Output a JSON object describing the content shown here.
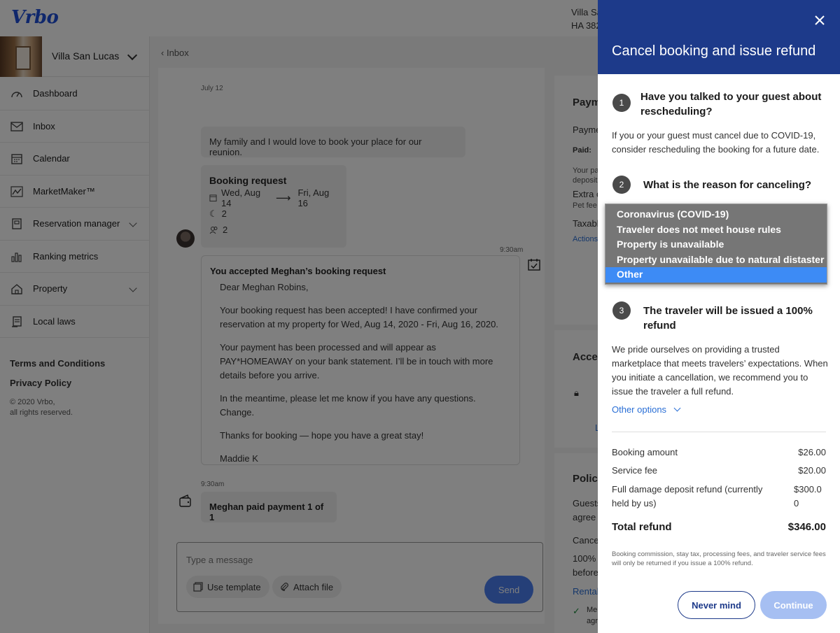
{
  "app": {
    "logo": "Vrbo"
  },
  "header": {
    "property_line1": "Villa Sa",
    "property_line2": "HA 382"
  },
  "property_switcher": {
    "name": "Villa San Lucas"
  },
  "sidebar": {
    "items": [
      {
        "label": "Dashboard",
        "icon": "speedometer-icon",
        "chevron": false
      },
      {
        "label": "Inbox",
        "icon": "envelope-icon",
        "chevron": false
      },
      {
        "label": "Calendar",
        "icon": "calendar-icon",
        "chevron": false
      },
      {
        "label": "MarketMaker™",
        "icon": "chart-line-icon",
        "chevron": false
      },
      {
        "label": "Reservation manager",
        "icon": "book-icon",
        "chevron": true
      },
      {
        "label": "Ranking metrics",
        "icon": "bar-chart-icon",
        "chevron": false
      },
      {
        "label": "Property",
        "icon": "house-icon",
        "chevron": true
      },
      {
        "label": "Local laws",
        "icon": "document-icon",
        "chevron": false
      }
    ],
    "terms": "Terms and Conditions",
    "privacy": "Privacy Policy",
    "copyright_line1": "© 2020 Vrbo,",
    "copyright_line2": "all rights reserved."
  },
  "chat": {
    "back_label": "Inbox",
    "date": "July 12",
    "message1": "My family and I would love to book your place for our reunion.",
    "booking": {
      "title": "Booking request",
      "start": "Wed, Aug 14",
      "end": "Fri, Aug 16",
      "nights": "2",
      "guests": "2"
    },
    "accepted_time": "9:30am",
    "accepted": {
      "title": "You accepted Meghan’s booking request",
      "greeting": "Dear Meghan Robins,",
      "p1": "Your booking request has been accepted! I have confirmed your reservation at my property for Wed, Aug 14, 2020 - Fri, Aug 16, 2020.",
      "p2": "Your payment has been processed and will appear as PAY*HOMEAWAY on your bank statement. I’ll be in touch with more details before you arrive.",
      "p3": "In the meantime, please let me know if you have any questions.  Change.",
      "p4": "Thanks for booking — hope you have a great stay!",
      "signature": "Maddie K"
    },
    "paid_time": "9:30am",
    "paid_message": "Meghan paid payment 1 of 1",
    "composer": {
      "placeholder": "Type a message",
      "template_label": "Use template",
      "attach_label": "Attach file",
      "send_label": "Send"
    }
  },
  "right_column": {
    "payment_heading": "Paym",
    "payment_sub": "Payme",
    "paid_label": "Paid:",
    "small1": "Your pa",
    "small2": "deposit",
    "extra": "Extra c",
    "pet": "Pet fee",
    "taxable": "Taxabl",
    "actions": "Actions",
    "access": "Acces",
    "access_link": "L",
    "policies": "Polici",
    "guests1": "Guests",
    "guests2": "agree",
    "cancel": "Cance",
    "pct": "100%",
    "before": "before",
    "rental": "Rental",
    "me": "Me",
    "agr": "agr"
  },
  "modal": {
    "title": "Cancel booking and issue refund",
    "step1_num": "1",
    "step1_question": "Have you talked to your guest about rescheduling?",
    "step1_text": "If you or your guest must cancel due to COVID-19, consider rescheduling the booking for a future date.",
    "step2_num": "2",
    "step2_question": "What is the reason for canceling?",
    "reasons": [
      "Coronavirus (COVID-19)",
      "Traveler does not meet house rules",
      "Property is unavailable",
      "Property unavailable due to natural distaster",
      "Other"
    ],
    "selected_reason": "Other",
    "step3_num": "3",
    "step3_question": "The traveler will be issued a 100% refund",
    "step3_text": "We pride ourselves on providing a trusted marketplace that meets travelers’ expectations. When you initiate a cancellation, we recommend you to issue the traveler a full refund.",
    "other_options": "Other options",
    "booking_amount_label": "Booking amount",
    "booking_amount": "$26.00",
    "service_fee_label": "Service fee",
    "service_fee": "$20.00",
    "deposit_label": "Full damage deposit refund (currently held by us)",
    "deposit_line1": "$300.0",
    "deposit_line2": "0",
    "total_label": "Total refund",
    "total": "$346.00",
    "fine_print": "Booking commission, stay tax, processing fees, and traveler service fees will only be returned if you issue a 100% refund.",
    "never_mind": "Never mind",
    "continue": "Continue"
  }
}
